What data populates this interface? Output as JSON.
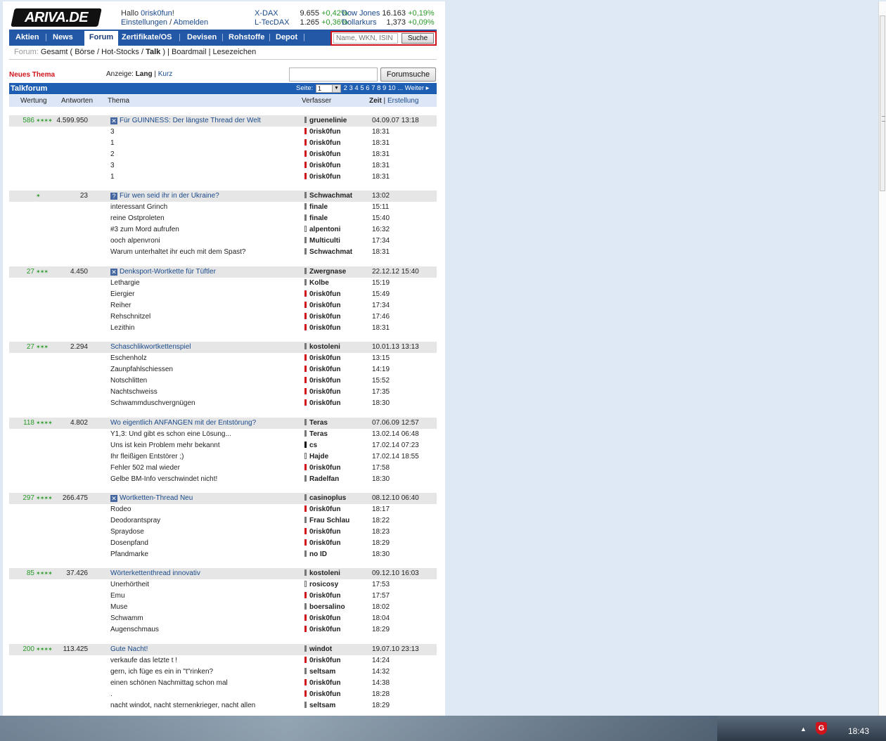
{
  "header": {
    "logo": "ARIVA.DE",
    "greeting": "Hallo",
    "username": "0risk0fun",
    "greeting_end": "!",
    "settings": "Einstellungen",
    "logout": "Abmelden"
  },
  "quotes": [
    {
      "name": "X-DAX",
      "value": "9.655",
      "change": "+0,42%"
    },
    {
      "name": "L-TecDAX",
      "value": "1.265",
      "change": "+0,36%"
    },
    {
      "name": "Dow Jones",
      "value": "16.163",
      "change": "+0,19%"
    },
    {
      "name": "Dollarkurs",
      "value": "1,373",
      "change": "+0,09%"
    }
  ],
  "nav": [
    "Aktien",
    "News",
    "Forum",
    "Zertifikate/OS",
    "Devisen",
    "Rohstoffe",
    "Depot"
  ],
  "search": {
    "placeholder": "Name, WKN, ISIN",
    "button": "Suche"
  },
  "breadcrumb": {
    "label": "Forum:",
    "all": "Gesamt",
    "b1": "Börse",
    "b2": "Hot-Stocks",
    "talk": "Talk",
    "boardmail": "Boardmail",
    "bookmarks": "Lesezeichen"
  },
  "toolbar": {
    "new_topic": "Neues Thema",
    "display_label": "Anzeige:",
    "long": "Lang",
    "short": "Kurz",
    "forum_search": "Forumsuche"
  },
  "forum": {
    "title": "Talkforum",
    "page_label": "Seite:",
    "page_value": "1",
    "pages": "2 3 4 5 6 7 8 9 10 ...",
    "next": "Weiter"
  },
  "columns": {
    "rating": "Wertung",
    "answers": "Antworten",
    "topic": "Thema",
    "author": "Verfasser",
    "time": "Zeit",
    "created": "Erstellung"
  },
  "threads": [
    {
      "rating": "586",
      "stars": "✶✶✶✶",
      "answers": "4.599.950",
      "icon": "✕",
      "title": "Für GUINNESS: Der längste Thread der Welt",
      "author": "gruenelinie",
      "mark": "gray",
      "time": "04.09.07 13:18",
      "replies": [
        {
          "text": "3",
          "author": "0risk0fun",
          "mark": "red",
          "time": "18:31"
        },
        {
          "text": "1",
          "author": "0risk0fun",
          "mark": "red",
          "time": "18:31"
        },
        {
          "text": "2",
          "author": "0risk0fun",
          "mark": "red",
          "time": "18:31"
        },
        {
          "text": "3",
          "author": "0risk0fun",
          "mark": "red",
          "time": "18:31"
        },
        {
          "text": "1",
          "author": "0risk0fun",
          "mark": "red",
          "time": "18:31"
        }
      ]
    },
    {
      "rating": "",
      "stars": "✶",
      "answers": "23",
      "icon": "?",
      "title": "Für wen seid ihr in der Ukraine?",
      "author": "Schwachmat",
      "mark": "gray",
      "time": "13:02",
      "replies": [
        {
          "text": "interessant Grinch",
          "author": "finale",
          "mark": "gray",
          "time": "15:11"
        },
        {
          "text": "reine Ostproleten",
          "author": "finale",
          "mark": "gray",
          "time": "15:40"
        },
        {
          "text": "#3 zum Mord aufrufen",
          "author": "alpentoni",
          "mark": "out",
          "time": "16:32"
        },
        {
          "text": "ooch alpenvroni",
          "author": "Multiculti",
          "mark": "gray",
          "time": "17:34"
        },
        {
          "text": "Warum unterhaltet ihr euch mit dem Spast?",
          "author": "Schwachmat",
          "mark": "gray",
          "time": "18:31"
        }
      ]
    },
    {
      "rating": "27",
      "stars": "✶✶✶",
      "answers": "4.450",
      "icon": "✕",
      "title": "Denksport-Wortkette für Tüftler",
      "author": "Zwergnase",
      "mark": "gray",
      "time": "22.12.12 15:40",
      "replies": [
        {
          "text": "Lethargie",
          "author": "Kolbe",
          "mark": "gray",
          "time": "15:19"
        },
        {
          "text": "Eiergier",
          "author": "0risk0fun",
          "mark": "red",
          "time": "15:49"
        },
        {
          "text": "Reiher",
          "author": "0risk0fun",
          "mark": "red",
          "time": "17:34"
        },
        {
          "text": "Rehschnitzel",
          "author": "0risk0fun",
          "mark": "red",
          "time": "17:46"
        },
        {
          "text": "Lezithin",
          "author": "0risk0fun",
          "mark": "red",
          "time": "18:31"
        }
      ]
    },
    {
      "rating": "27",
      "stars": "✶✶✶",
      "answers": "2.294",
      "icon": "",
      "title": "Schaschlikwortkettenspiel",
      "author": "kostoleni",
      "mark": "gray",
      "time": "10.01.13 13:13",
      "replies": [
        {
          "text": "Eschenholz",
          "author": "0risk0fun",
          "mark": "red",
          "time": "13:15"
        },
        {
          "text": "Zaunpfahlschiessen",
          "author": "0risk0fun",
          "mark": "red",
          "time": "14:19"
        },
        {
          "text": "Notschlitten",
          "author": "0risk0fun",
          "mark": "red",
          "time": "15:52"
        },
        {
          "text": "Nachtschweiss",
          "author": "0risk0fun",
          "mark": "red",
          "time": "17:35"
        },
        {
          "text": "Schwammduschvergnügen",
          "author": "0risk0fun",
          "mark": "red",
          "time": "18:30"
        }
      ]
    },
    {
      "rating": "118",
      "stars": "✶✶✶✶",
      "answers": "4.802",
      "icon": "",
      "title": "Wo eigentlich ANFANGEN mit der Entstörung?",
      "author": "Teras",
      "mark": "gray",
      "time": "07.06.09 12:57",
      "replies": [
        {
          "text": "Y1,3: Und gibt es schon eine Lösung...",
          "author": "Teras",
          "mark": "gray",
          "time": "13.02.14 06:48"
        },
        {
          "text": "Uns ist kein Problem mehr bekannt",
          "author": "cs",
          "mark": "blk",
          "time": "17.02.14 07:23"
        },
        {
          "text": "Ihr fleißigen Entstörer ;)",
          "author": "Hajde",
          "mark": "out",
          "time": "17.02.14 18:55"
        },
        {
          "text": "Fehler 502 mal wieder",
          "author": "0risk0fun",
          "mark": "red",
          "time": "17:58"
        },
        {
          "text": "Gelbe BM-Info verschwindet nicht!",
          "author": "Radelfan",
          "mark": "gray",
          "time": "18:30"
        }
      ]
    },
    {
      "rating": "297",
      "stars": "✶✶✶✶",
      "answers": "266.475",
      "icon": "✕",
      "title": "Wortketten-Thread Neu",
      "author": "casinoplus",
      "mark": "gray",
      "time": "08.12.10 06:40",
      "replies": [
        {
          "text": "Rodeo",
          "author": "0risk0fun",
          "mark": "red",
          "time": "18:17"
        },
        {
          "text": "Deodorantspray",
          "author": "Frau Schlau",
          "mark": "gray",
          "time": "18:22"
        },
        {
          "text": "Spraydose",
          "author": "0risk0fun",
          "mark": "red",
          "time": "18:23"
        },
        {
          "text": "Dosenpfand",
          "author": "0risk0fun",
          "mark": "red",
          "time": "18:29"
        },
        {
          "text": "Pfandmarke",
          "author": "no ID",
          "mark": "gray",
          "time": "18:30"
        }
      ]
    },
    {
      "rating": "85",
      "stars": "✶✶✶✶",
      "answers": "37.426",
      "icon": "",
      "title": "Wörterkettenthread innovativ",
      "author": "kostoleni",
      "mark": "gray",
      "time": "09.12.10 16:03",
      "replies": [
        {
          "text": "Unerhörtheit",
          "author": "rosicosy",
          "mark": "out",
          "time": "17:53"
        },
        {
          "text": "Emu",
          "author": "0risk0fun",
          "mark": "red",
          "time": "17:57"
        },
        {
          "text": "Muse",
          "author": "boersalino",
          "mark": "gray",
          "time": "18:02"
        },
        {
          "text": "Schwamm",
          "author": "0risk0fun",
          "mark": "red",
          "time": "18:04"
        },
        {
          "text": "Augenschmaus",
          "author": "0risk0fun",
          "mark": "red",
          "time": "18:29"
        }
      ]
    },
    {
      "rating": "200",
      "stars": "✶✶✶✶",
      "answers": "113.425",
      "icon": "",
      "title": "Gute Nacht!",
      "author": "windot",
      "mark": "gray",
      "time": "19.07.10 23:13",
      "replies": [
        {
          "text": "verkaufe das letzte t !",
          "author": "0risk0fun",
          "mark": "red",
          "time": "14:24"
        },
        {
          "text": "gern, ich füge es ein in \"t\"rinken?",
          "author": "seltsam",
          "mark": "gray",
          "time": "14:32"
        },
        {
          "text": "einen schönen Nachmittag schon mal",
          "author": "0risk0fun",
          "mark": "red",
          "time": "14:38"
        },
        {
          "text": ".",
          "author": "0risk0fun",
          "mark": "red",
          "time": "18:28"
        },
        {
          "text": "nacht windot, nacht sternenkrieger, nacht allen",
          "author": "seltsam",
          "mark": "gray",
          "time": "18:29"
        }
      ]
    }
  ],
  "taskbar": {
    "clock": "18:43"
  }
}
